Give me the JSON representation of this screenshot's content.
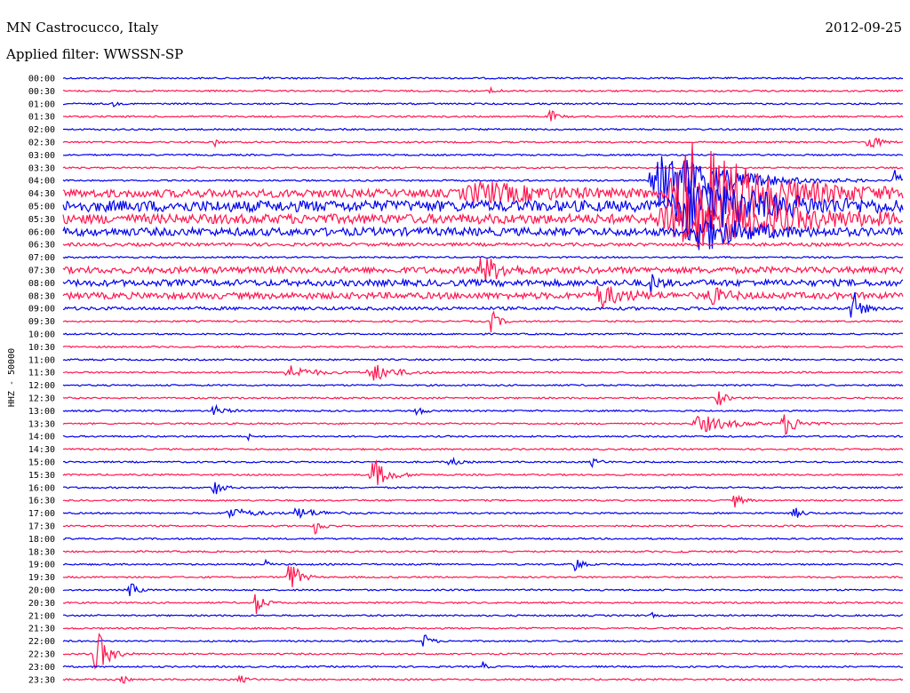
{
  "header": {
    "station": "MN Castrocucco, Italy",
    "date": "2012-09-25",
    "filter": "Applied filter: WWSSN-SP"
  },
  "chart_data": {
    "type": "line",
    "ylabel": "HHZ - 50000",
    "colors": [
      "#0000ee",
      "#ff1650"
    ],
    "rows": [
      "00:00",
      "00:30",
      "01:00",
      "01:30",
      "02:00",
      "02:30",
      "03:00",
      "03:30",
      "04:00",
      "04:30",
      "05:00",
      "05:30",
      "06:00",
      "06:30",
      "07:00",
      "07:30",
      "08:00",
      "08:30",
      "09:00",
      "09:30",
      "10:00",
      "10:30",
      "11:00",
      "11:30",
      "12:00",
      "12:30",
      "13:00",
      "13:30",
      "14:00",
      "14:30",
      "15:00",
      "15:30",
      "16:00",
      "16:30",
      "17:00",
      "17:30",
      "18:00",
      "18:30",
      "19:00",
      "19:30",
      "20:00",
      "20:30",
      "21:00",
      "21:30",
      "22:00",
      "22:30",
      "23:00",
      "23:30"
    ],
    "noise": [
      1,
      1,
      1,
      1,
      1,
      1,
      1,
      1,
      1,
      5,
      7,
      6,
      5,
      2,
      1,
      4,
      4,
      4,
      2,
      1,
      1,
      1,
      1,
      1,
      1,
      1,
      1,
      1,
      1,
      1,
      1,
      1,
      1,
      1,
      1,
      1,
      1,
      1,
      1,
      1,
      1,
      1,
      1,
      1,
      1,
      1,
      1,
      1
    ],
    "events": [
      {
        "row": 0,
        "t": 0.24,
        "a": 3,
        "d": 0.004
      },
      {
        "row": 1,
        "t": 0.51,
        "a": 5,
        "d": 0.008
      },
      {
        "row": 2,
        "t": 0.06,
        "a": 3,
        "d": 0.005
      },
      {
        "row": 3,
        "t": 0.58,
        "a": 9,
        "d": 0.008
      },
      {
        "row": 5,
        "t": 0.18,
        "a": 6,
        "d": 0.005
      },
      {
        "row": 5,
        "t": 0.96,
        "a": 12,
        "d": 0.012
      },
      {
        "row": 8,
        "t": 0.72,
        "a": 35,
        "d": 0.08
      },
      {
        "row": 8,
        "t": 0.99,
        "a": 12,
        "d": 0.01
      },
      {
        "row": 9,
        "t": 0.5,
        "a": 10,
        "d": 0.1
      },
      {
        "row": 9,
        "t": 0.75,
        "a": 60,
        "d": 0.1
      },
      {
        "row": 10,
        "t": 0.75,
        "a": 30,
        "d": 0.1
      },
      {
        "row": 11,
        "t": 0.74,
        "a": 35,
        "d": 0.12
      },
      {
        "row": 12,
        "t": 0.76,
        "a": 20,
        "d": 0.06
      },
      {
        "row": 15,
        "t": 0.5,
        "a": 14,
        "d": 0.03
      },
      {
        "row": 16,
        "t": 0.7,
        "a": 10,
        "d": 0.01
      },
      {
        "row": 17,
        "t": 0.64,
        "a": 12,
        "d": 0.03
      },
      {
        "row": 17,
        "t": 0.77,
        "a": 10,
        "d": 0.02
      },
      {
        "row": 18,
        "t": 0.94,
        "a": 25,
        "d": 0.01
      },
      {
        "row": 19,
        "t": 0.51,
        "a": 14,
        "d": 0.01
      },
      {
        "row": 23,
        "t": 0.27,
        "a": 8,
        "d": 0.03
      },
      {
        "row": 23,
        "t": 0.37,
        "a": 10,
        "d": 0.03
      },
      {
        "row": 25,
        "t": 0.78,
        "a": 10,
        "d": 0.01
      },
      {
        "row": 26,
        "t": 0.18,
        "a": 6,
        "d": 0.015
      },
      {
        "row": 26,
        "t": 0.42,
        "a": 6,
        "d": 0.01
      },
      {
        "row": 27,
        "t": 0.76,
        "a": 10,
        "d": 0.04
      },
      {
        "row": 27,
        "t": 0.86,
        "a": 12,
        "d": 0.02
      },
      {
        "row": 28,
        "t": 0.22,
        "a": 8,
        "d": 0.002
      },
      {
        "row": 30,
        "t": 0.46,
        "a": 6,
        "d": 0.01
      },
      {
        "row": 30,
        "t": 0.63,
        "a": 5,
        "d": 0.01
      },
      {
        "row": 31,
        "t": 0.37,
        "a": 18,
        "d": 0.02
      },
      {
        "row": 32,
        "t": 0.18,
        "a": 10,
        "d": 0.01
      },
      {
        "row": 33,
        "t": 0.8,
        "a": 8,
        "d": 0.01
      },
      {
        "row": 34,
        "t": 0.2,
        "a": 6,
        "d": 0.03
      },
      {
        "row": 34,
        "t": 0.28,
        "a": 6,
        "d": 0.03
      },
      {
        "row": 34,
        "t": 0.87,
        "a": 8,
        "d": 0.01
      },
      {
        "row": 35,
        "t": 0.3,
        "a": 10,
        "d": 0.01
      },
      {
        "row": 37,
        "t": 0.73,
        "a": 6,
        "d": 0.005
      },
      {
        "row": 38,
        "t": 0.24,
        "a": 6,
        "d": 0.005
      },
      {
        "row": 38,
        "t": 0.61,
        "a": 10,
        "d": 0.008
      },
      {
        "row": 39,
        "t": 0.27,
        "a": 22,
        "d": 0.012
      },
      {
        "row": 40,
        "t": 0.08,
        "a": 12,
        "d": 0.008
      },
      {
        "row": 41,
        "t": 0.23,
        "a": 14,
        "d": 0.01
      },
      {
        "row": 42,
        "t": 0.7,
        "a": 4,
        "d": 0.004
      },
      {
        "row": 44,
        "t": 0.43,
        "a": 10,
        "d": 0.008
      },
      {
        "row": 45,
        "t": 0.04,
        "a": 30,
        "d": 0.015
      },
      {
        "row": 46,
        "t": 0.5,
        "a": 5,
        "d": 0.005
      },
      {
        "row": 47,
        "t": 0.07,
        "a": 6,
        "d": 0.006
      },
      {
        "row": 47,
        "t": 0.21,
        "a": 5,
        "d": 0.01
      }
    ]
  }
}
